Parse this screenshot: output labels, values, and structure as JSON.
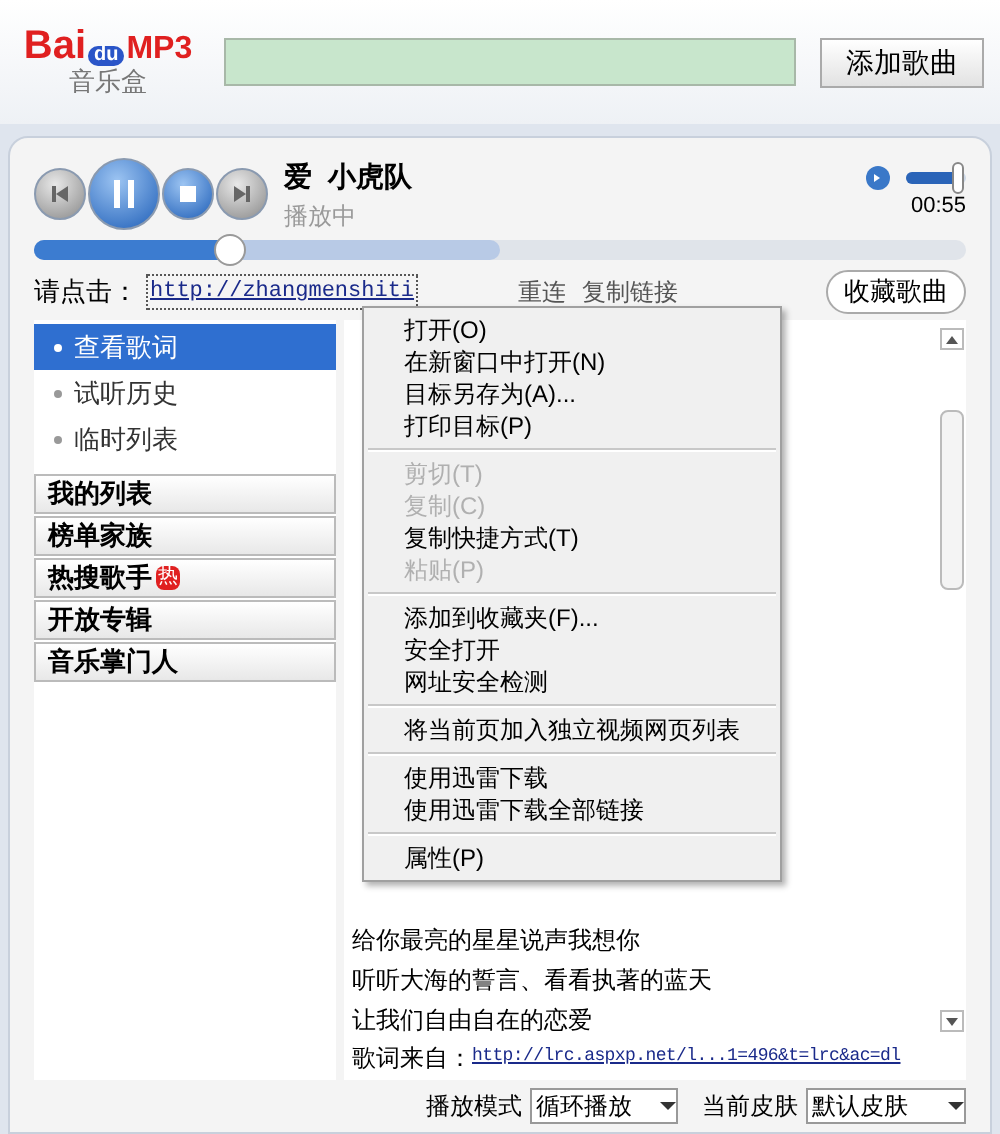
{
  "header": {
    "logo_text": "Bai",
    "logo_badge": "du",
    "logo_suffix": "MP3",
    "logo_subtitle": "音乐盒",
    "add_button": "添加歌曲"
  },
  "player": {
    "title": "爱  小虎队",
    "status": "播放中",
    "time": "00:55",
    "volume": {
      "level": 0.85
    },
    "progress": {
      "level": 0.21
    }
  },
  "link_row": {
    "label": "请点击：",
    "url": "http://zhangmenshiti",
    "actions": [
      "重连",
      "复制链接"
    ],
    "favorite_button": "收藏歌曲"
  },
  "sidebar": {
    "tabs": [
      {
        "label": "查看歌词",
        "selected": true
      },
      {
        "label": "试听历史",
        "selected": false
      },
      {
        "label": "临时列表",
        "selected": false
      }
    ],
    "groups": [
      {
        "label": "我的列表"
      },
      {
        "label": "榜单家族"
      },
      {
        "label": "热搜歌手",
        "badge": "热"
      },
      {
        "label": "开放专辑"
      },
      {
        "label": "音乐掌门人"
      }
    ]
  },
  "lyrics": {
    "lines": [
      "给你最亮的星星说声我想你",
      "听听大海的誓言、看看执著的蓝天",
      "让我们自由自在的恋爱"
    ],
    "source_label": "歌词来自：",
    "source_url": "http://lrc.aspxp.net/l...1=496&t=lrc&ac=dl"
  },
  "context_menu": [
    {
      "kind": "item",
      "label": "打开(O)",
      "disabled": false
    },
    {
      "kind": "item",
      "label": "在新窗口中打开(N)",
      "disabled": false
    },
    {
      "kind": "item",
      "label": "目标另存为(A)...",
      "disabled": false
    },
    {
      "kind": "item",
      "label": "打印目标(P)",
      "disabled": false
    },
    {
      "kind": "separator"
    },
    {
      "kind": "item",
      "label": "剪切(T)",
      "disabled": true
    },
    {
      "kind": "item",
      "label": "复制(C)",
      "disabled": true
    },
    {
      "kind": "item",
      "label": "复制快捷方式(T)",
      "disabled": false
    },
    {
      "kind": "item",
      "label": "粘贴(P)",
      "disabled": true
    },
    {
      "kind": "separator"
    },
    {
      "kind": "item",
      "label": "添加到收藏夹(F)...",
      "disabled": false
    },
    {
      "kind": "item",
      "label": "安全打开",
      "disabled": false
    },
    {
      "kind": "item",
      "label": "网址安全检测",
      "disabled": false
    },
    {
      "kind": "separator"
    },
    {
      "kind": "item",
      "label": "将当前页加入独立视频网页列表",
      "disabled": false
    },
    {
      "kind": "separator"
    },
    {
      "kind": "item",
      "label": "使用迅雷下载",
      "disabled": false
    },
    {
      "kind": "item",
      "label": "使用迅雷下载全部链接",
      "disabled": false
    },
    {
      "kind": "separator"
    },
    {
      "kind": "item",
      "label": "属性(P)",
      "disabled": false
    }
  ],
  "footer": {
    "mode_label": "播放模式",
    "mode_value": "循环播放",
    "skin_label": "当前皮肤",
    "skin_value": "默认皮肤"
  }
}
